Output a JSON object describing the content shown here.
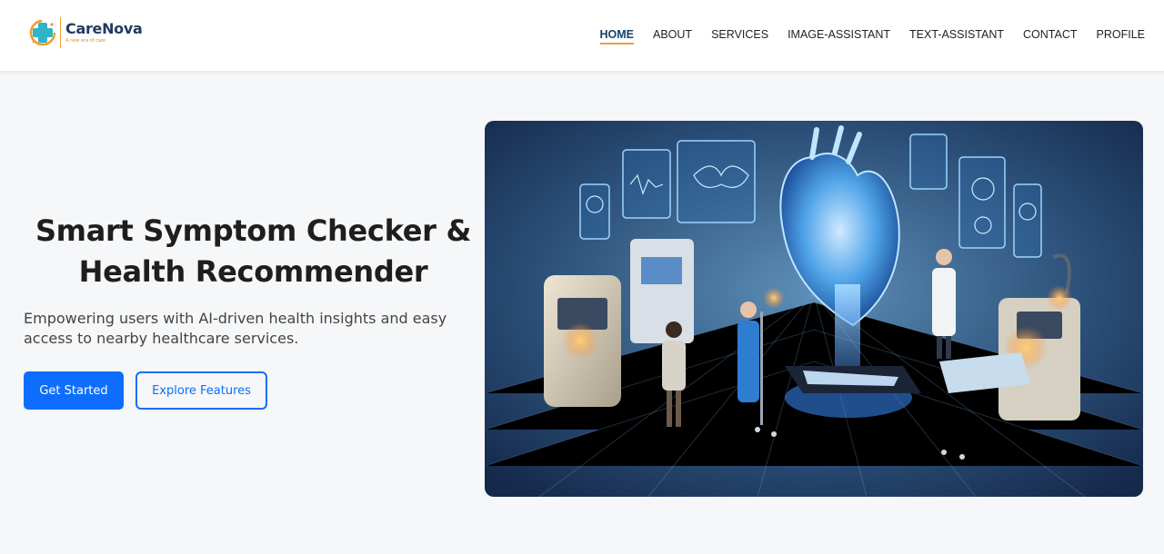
{
  "brand": {
    "name": "CareNova",
    "tagline": "A new era of care"
  },
  "nav": {
    "items": [
      "HOME",
      "ABOUT",
      "SERVICES",
      "IMAGE-ASSISTANT",
      "TEXT-ASSISTANT",
      "CONTACT",
      "PROFILE"
    ],
    "active": "HOME"
  },
  "hero": {
    "title": "Smart Symptom Checker & Health Recommender",
    "subtitle": "Empowering users with AI-driven health insights and easy access to nearby healthcare services.",
    "primary_button": "Get Started",
    "secondary_button": "Explore Features"
  },
  "colors": {
    "primary": "#0d6efd",
    "nav_active": "#13426b",
    "accent": "#e8a43a",
    "brand_teal": "#2fb3c6",
    "brand_orange": "#f39a2b"
  },
  "icons": {
    "logo": "medical-cross-icon"
  }
}
